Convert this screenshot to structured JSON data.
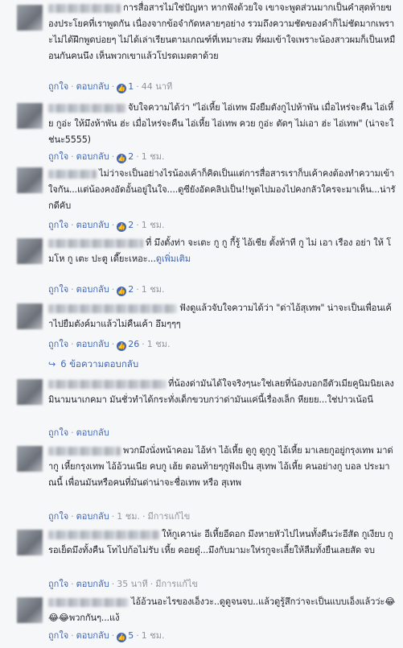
{
  "actions": {
    "like": "ถูกใจ",
    "reply": "ตอบกลับ",
    "sep": "·",
    "edited": "มีการแก้ไข"
  },
  "comments": [
    {
      "text": "การสื่อสารไม่ใช่ปัญหา หากฟังด้วยใจ เขาจะพูดส่วนมากเป็นคำสุดท้ายของประโยคที่เราพูดกัน เนื่องจากข้อจำกัดหลายๆอย่าง รวมถึงความชัดของคำก็ไม่ชัดมากเพราะไม่ได้ฝึกพูดบ่อยๆ ไม่ได้เล่าเรียนตามเกณฑ์ที่เหมาะสม ที่ผมเข้าใจเพราะน้องสาวผมก็เป็นเหมือนกันคนนึง เห็นพวกเขาแล้วโปรดเมตตาด้วย",
      "likes": "1",
      "time": "44 นาที",
      "edited": false
    },
    {
      "text": "จับใจความได้ว่า \"ไอ่เหี้ย ไอ่เทพ มึงยืมตังกูไปห้าพัน เมื่อไหร่จะคืน ไอ่เหี้ย กูอ่ะ ให้มึงห้าพัน ฮ่ะ เมื่อไหร่จะคืน ไอ่เหี้ย ไอ่เทพ ควย กูอ่ะ ตัดๆ ไม่เอา ฮ่ะ ไอ่เทพ\" (น่าจะใช่นะ5555)",
      "likes": "2",
      "time": "1 ชม.",
      "edited": false
    },
    {
      "text": "ไม่ว่าจะเป็นอย่างไรน้องเค้าก็คิดเป็นแต่การสื่อสารเราก็บเค้าคงต้องทำความเข้าใจกัน...แต่น้องคงอัดอั้นอยู่ในใจ....ดูซียังอัดคลิปเป็น!!พูดไปมองไปคงกลัวใครจะมาเห็น...น่ารักดีคับ",
      "likes": "2",
      "time": "1 ชม.",
      "edited": false
    },
    {
      "text": "ที่ มึงตั้งท่า จะเตะ กู กู กี้รู้ ไอ้เชีย ตั้งห้าที กู ไม่ เอา เรือง อย่า ให้ โมโห กู เตะ ปะตู เดี๊ยะเหอะ...",
      "see_more": "ดูเพิ่มเติม",
      "likes": "2",
      "time": "1 ชม.",
      "edited": false
    },
    {
      "text": "ฟังดูแล้วจับใจความได้ว่า \"ด่าไอ้สุเทพ\" น่าจะเป็นเพื่อนเค้าไปยืมตังค์มาแล้วไม่คืนเค้า อึมๆๆๆ",
      "likes": "26",
      "time": "1 ชม.",
      "edited": false
    },
    {
      "text": "ที่น้องด่ามันได้ใจจริงๆนะใช่เลยที่น้องบอกอีตัวเมียคูนิมนิยเลง มินามนาเกคมา มันชั่วทำได้กระทั่งเด็กขวบกว่าด่ามันแค่นี้เรื่องเล็ก หียยย...ใช่ปาวเน้อนี",
      "likes": "",
      "time": "",
      "edited": false
    },
    {
      "text": "พวกมึงนั่งหน้าคอม ไอ้ห่า ไอ้เหี้ย ดูกู ดูกูกู ไอ้เหี้ย มาเลยกูอยู่กรุงเทพ มาด่ากู เหี้ยกรุงเทพ ไอ้อ้วนเนีย คบกู เฮ้ย ตอนท้ายๆกูฟังเป็น สุเทพ ไอ้เหี้ย คนอย่างกู บอล ประมาณนี้ เพื่อนมันหรือคนที่มันด่าน่าจะชื่อเทพ หรือ สุเทพ",
      "likes": "",
      "time": "1 ชม.",
      "edited": true
    },
    {
      "text": "ให้กูเคาน่ะ อีเหี้ยอีดอก มึงหายหัวไปไหนทั้งคืนว่ะอีสัด กูเงียบ กูรอเย็ดมึงทั้งคืน โทไปก้อไม่รับ เหี้ย คอยดู๋...มึงกับมามะให่รกูจะเลี้ยให้ลืมทั้งยืนเลยสัด จบ",
      "likes": "",
      "time": "35 นาที",
      "edited": true
    },
    {
      "text": "ไอ้อ้วนอะไรของเอ็งวะ..ดูดูจนจบ..แล้วดูรู้สึกว่าจะเป็นแบบเอ็งแล้วว่ะ😂😂😂พวกกันๆ...แง้",
      "likes": "5",
      "time": "1 ชม.",
      "edited": false
    }
  ],
  "replies_link": "6 ข้อความตอบกลับ"
}
